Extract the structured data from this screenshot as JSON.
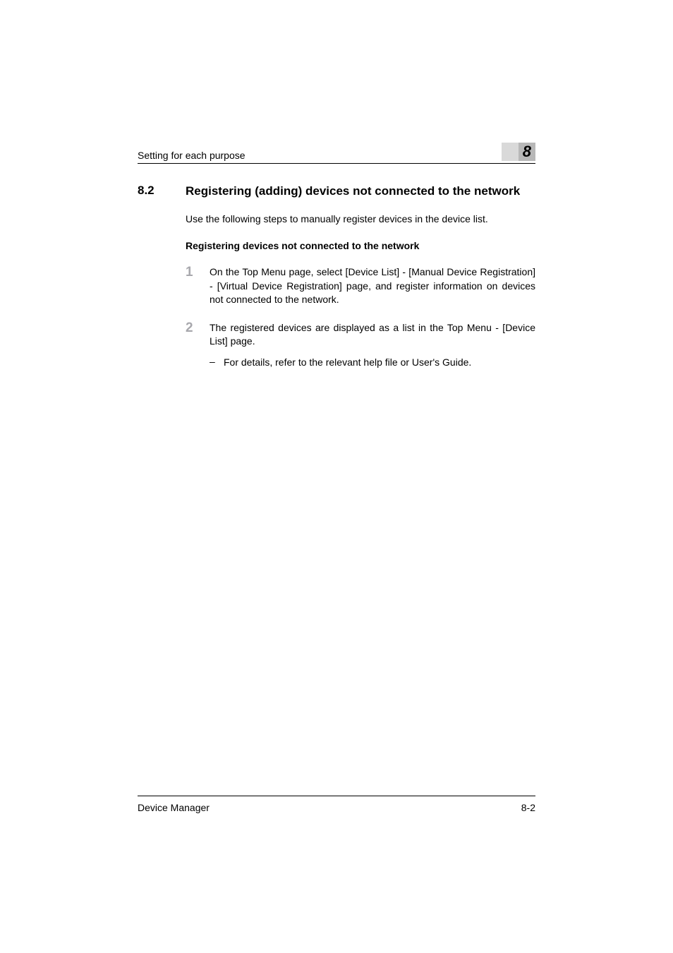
{
  "header": {
    "running_head": "Setting for each purpose",
    "chapter_number": "8"
  },
  "section": {
    "number": "8.2",
    "title": "Registering (adding) devices not connected to the network"
  },
  "intro": "Use the following steps to manually register devices in the device list.",
  "subheading": "Registering devices not connected to the network",
  "steps": [
    {
      "number": "1",
      "text": "On the Top Menu page, select [Device List] - [Manual Device Registration] - [Virtual Device Registration] page, and register information on devices not connected to the network."
    },
    {
      "number": "2",
      "text": "The registered devices are displayed as a list in the Top Menu - [Device List] page.",
      "bullet": "For details, refer to the relevant help file or User's Guide."
    }
  ],
  "footer": {
    "left": "Device Manager",
    "right": "8-2"
  }
}
